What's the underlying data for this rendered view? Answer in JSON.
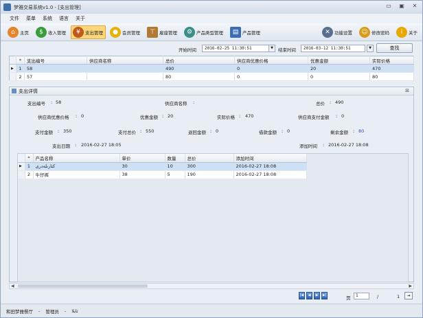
{
  "window": {
    "title": "梦雅交易系统v1.0 - [支出管理]"
  },
  "menu": [
    "文件",
    "菜单",
    "系统",
    "语言",
    "关于"
  ],
  "toolbar": {
    "items": [
      {
        "label": "主页",
        "icon": "home-icon",
        "color": "#e5842a"
      },
      {
        "label": "收入管理",
        "icon": "money-in-icon",
        "color": "#3a9b3a"
      },
      {
        "label": "支出管理",
        "icon": "money-out-icon",
        "color": "#c05a1c",
        "active": true
      },
      {
        "label": "会员管理",
        "icon": "member-icon",
        "color": "#e8b10c"
      },
      {
        "label": "雇座管理",
        "icon": "table-icon",
        "color": "#b07a35"
      },
      {
        "label": "产品类型管理",
        "icon": "gear-icon",
        "color": "#3b8e88"
      },
      {
        "label": "产品管理",
        "icon": "product-icon",
        "color": "#3b6db3"
      }
    ],
    "right_items": [
      {
        "label": "功能设置",
        "icon": "tools-icon",
        "color": "#5a6f8f"
      },
      {
        "label": "修改密码",
        "icon": "user-key-icon",
        "color": "#d89b1a"
      },
      {
        "label": "关于",
        "icon": "info-icon",
        "color": "#e8a800"
      }
    ]
  },
  "filter": {
    "start_label": "开始时间",
    "start_value": "2016-02-25 11:30:51",
    "end_label": "结束时间",
    "end_value": "2016-03-12 11:30:51",
    "search_label": "查找"
  },
  "expense_table": {
    "columns": [
      "*",
      "支出编号",
      "供应商名称",
      "总价",
      "供应商优惠价格",
      "优惠金额",
      "实际价格"
    ],
    "rows": [
      {
        "num": "1",
        "id": "58",
        "supplier": "",
        "total": "490",
        "supplier_discount": "0",
        "discount": "20",
        "actual": "470"
      },
      {
        "num": "2",
        "id": "57",
        "supplier": "",
        "total": "80",
        "supplier_discount": "0",
        "discount": "0",
        "actual": "80"
      }
    ]
  },
  "detail": {
    "title": "支出详情",
    "close_label": "⊠",
    "fields": {
      "expense_id_label": "支出编号",
      "expense_id": "58",
      "supplier_name_label": "供应商名称",
      "supplier_name": "",
      "total_label": "总价",
      "total": "490",
      "supplier_discount_label": "供应商优惠价格",
      "supplier_discount": "0",
      "discount_label": "优惠金额",
      "discount": "20",
      "actual_label": "实际价格",
      "actual": "470",
      "supplier_paid_label": "供应商支付金额",
      "supplier_paid": "0",
      "paid_label": "支付金额",
      "paid": "350",
      "paid_total_label": "支付总价",
      "paid_total": "550",
      "refund_label": "退回金额",
      "refund": "0",
      "borrow_label": "借款金额",
      "borrow": "0",
      "remaining_label": "剩余金额",
      "remaining": "80",
      "date_label": "支出日期",
      "date": "2016-02-27 18:05",
      "added_label": "添加时间",
      "added": "2016-02-27 18:08"
    },
    "items_table": {
      "columns": [
        "*",
        "产品名称",
        "单价",
        "数量",
        "总价",
        "添加时间"
      ],
      "rows": [
        {
          "num": "1",
          "name": "كنارىلەدرى",
          "price": "30",
          "qty": "10",
          "total": "300",
          "added": "2016-02-27 18:08"
        },
        {
          "num": "2",
          "name": "牛仔裤",
          "price": "38",
          "qty": "5",
          "total": "190",
          "added": "2016-02-27 18:08"
        }
      ]
    }
  },
  "pager": {
    "page_label": "页",
    "page_value": "1",
    "slash": "/",
    "total_pages": "1"
  },
  "status": {
    "shop": "和田梦雅餐厅",
    "sep1": "-",
    "role": "管理员",
    "sep2": "-",
    "user": "ئابلا"
  }
}
